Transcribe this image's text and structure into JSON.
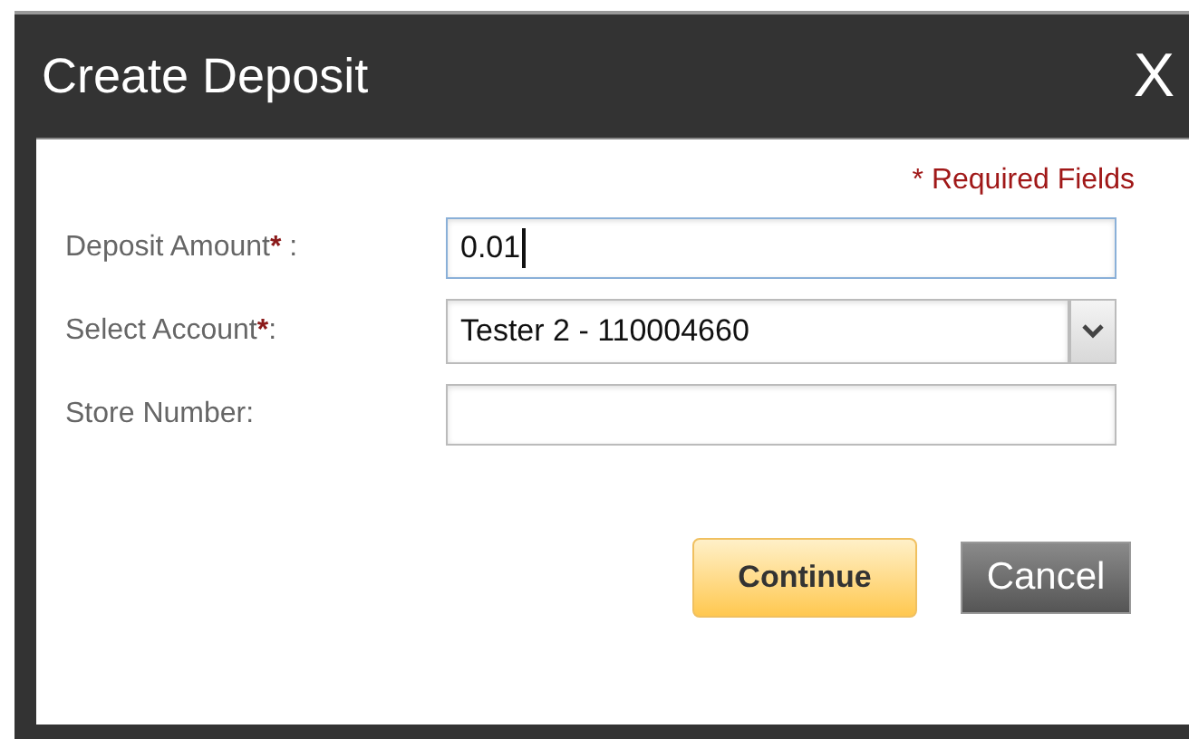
{
  "dialog": {
    "title": "Create Deposit",
    "close": "X"
  },
  "required_note": "* Required Fields",
  "fields": [
    {
      "kind": "text",
      "label": "Deposit Amount",
      "required_mark": "*",
      "suffix": " :",
      "value": "0.01",
      "focused": true
    },
    {
      "kind": "select",
      "label": "Select Account",
      "required_mark": "*",
      "suffix": ":",
      "value": "Tester 2 - 110004660",
      "focused": false
    },
    {
      "kind": "text",
      "label": "Store Number",
      "suffix": ":",
      "focused": false
    }
  ],
  "buttons": [
    {
      "kind": "primary",
      "label": "Continue"
    },
    {
      "kind": "secondary",
      "label": "Cancel"
    }
  ]
}
